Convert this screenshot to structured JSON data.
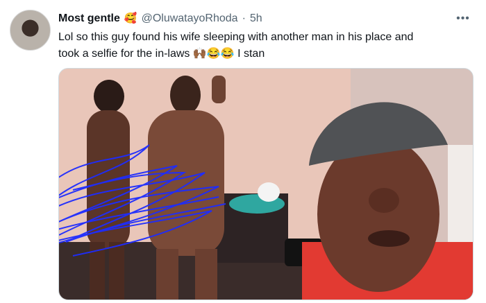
{
  "tweet": {
    "display_name": "Most gentle",
    "name_emoji": "🥰",
    "handle": "@OluwatayoRhoda",
    "separator": "·",
    "time": "5h",
    "more_glyph": "•••",
    "text_line1": "Lol so this guy found his wife sleeping with another man in his place and",
    "text_line2": "took a selfie for the in-laws 🙌🏾😂😂 I stan"
  },
  "colors": {
    "text": "#0f1419",
    "secondary": "#536471",
    "scribble": "#1d2cff",
    "wall": "#e8c3b6"
  }
}
